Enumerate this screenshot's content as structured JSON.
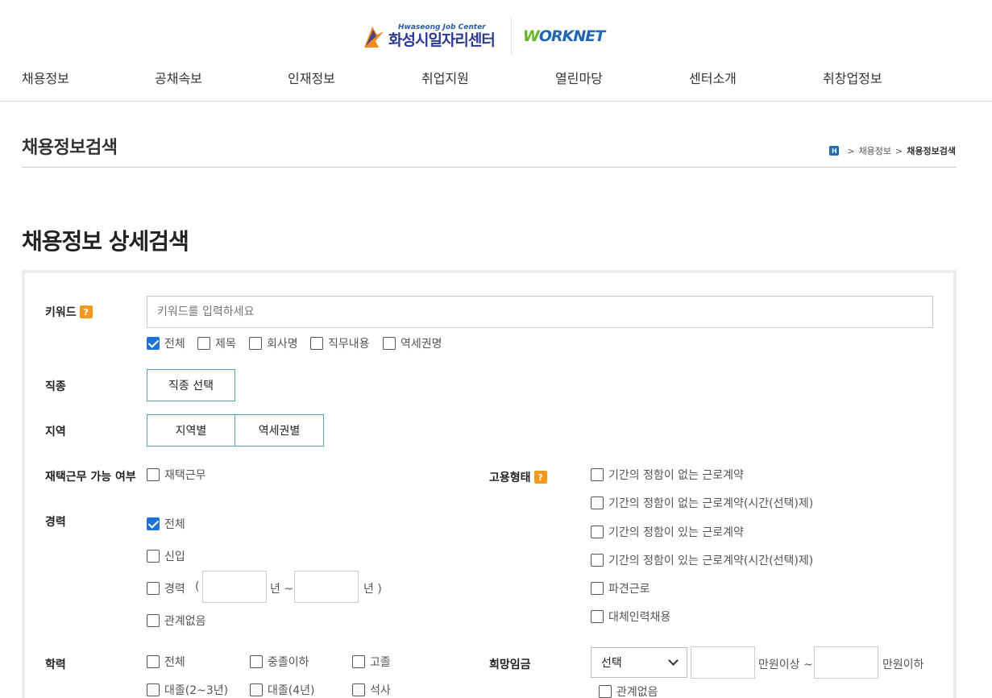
{
  "header": {
    "logo_small": "Hwaseong Job Center",
    "logo_big": "화성시일자리센터",
    "worknet_w": "W",
    "worknet_rest": "ORKNET"
  },
  "nav": [
    "채용정보",
    "공채속보",
    "인재정보",
    "취업지원",
    "열린마당",
    "센터소개",
    "취창업정보"
  ],
  "page": {
    "title": "채용정보검색",
    "breadcrumb_home": "H",
    "breadcrumb": [
      "채용정보",
      "채용정보검색"
    ]
  },
  "search": {
    "heading": "채용정보 상세검색",
    "keyword": {
      "label": "키워드",
      "help": "?",
      "placeholder": "키워드를 입력하세요",
      "options": [
        {
          "label": "전체",
          "checked": true
        },
        {
          "label": "제목",
          "checked": false
        },
        {
          "label": "회사명",
          "checked": false
        },
        {
          "label": "직무내용",
          "checked": false
        },
        {
          "label": "역세권명",
          "checked": false
        }
      ]
    },
    "job_type": {
      "label": "직종",
      "button": "직종 선택"
    },
    "region": {
      "label": "지역",
      "buttons": [
        "지역별",
        "역세권별"
      ]
    },
    "remote": {
      "label": "재택근무 가능 여부",
      "option": "재택근무"
    },
    "career": {
      "label": "경력",
      "options": [
        "전체",
        "신입",
        "경력",
        "관계없음"
      ],
      "paren_open": "(",
      "year_from": "년 ~",
      "year_to": "년 )"
    },
    "employment": {
      "label": "고용형태",
      "help": "?",
      "options": [
        "기간의 정함이 없는 근로계약",
        "기간의 정함이 없는 근로계약(시간(선택)제)",
        "기간의 정함이 있는 근로계약",
        "기간의 정함이 있는 근로계약(시간(선택)제)",
        "파견근로",
        "대체인력채용"
      ]
    },
    "education": {
      "label": "학력",
      "options": [
        "전체",
        "중졸이하",
        "고졸",
        "대졸(2~3년)",
        "대졸(4년)",
        "석사"
      ]
    },
    "salary": {
      "label": "희망임금",
      "select_value": "선택",
      "min_suffix": "만원이상 ~",
      "max_suffix": "만원이하",
      "no_matter": "관계없음"
    }
  }
}
